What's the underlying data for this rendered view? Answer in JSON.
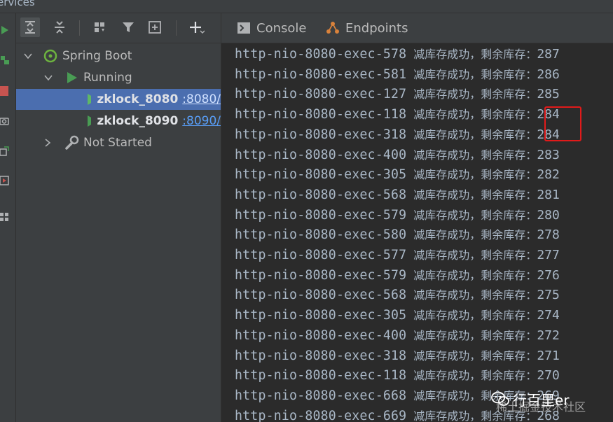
{
  "window": {
    "title_fragment": "ervices"
  },
  "tree": {
    "spring_boot": "Spring Boot",
    "running": "Running",
    "apps": [
      {
        "name": "zklock_8080",
        "port": ":8080/"
      },
      {
        "name": "zklock_8090",
        "port": ":8090/"
      }
    ],
    "not_started": "Not Started"
  },
  "tabs": {
    "console": "Console",
    "endpoints": "Endpoints"
  },
  "console": {
    "lines": [
      {
        "thread": "http-nio-8080-exec-578",
        "message": "减库存成功，剩余库存：",
        "value": "287"
      },
      {
        "thread": "http-nio-8080-exec-581",
        "message": "减库存成功，剩余库存：",
        "value": "286"
      },
      {
        "thread": "http-nio-8080-exec-127",
        "message": "减库存成功，剩余库存：",
        "value": "285"
      },
      {
        "thread": "http-nio-8080-exec-118",
        "message": "减库存成功，剩余库存：",
        "value": "284"
      },
      {
        "thread": "http-nio-8080-exec-318",
        "message": "减库存成功，剩余库存：",
        "value": "284"
      },
      {
        "thread": "http-nio-8080-exec-400",
        "message": "减库存成功，剩余库存：",
        "value": "283"
      },
      {
        "thread": "http-nio-8080-exec-305",
        "message": "减库存成功，剩余库存：",
        "value": "282"
      },
      {
        "thread": "http-nio-8080-exec-568",
        "message": "减库存成功，剩余库存：",
        "value": "281"
      },
      {
        "thread": "http-nio-8080-exec-579",
        "message": "减库存成功，剩余库存：",
        "value": "280"
      },
      {
        "thread": "http-nio-8080-exec-580",
        "message": "减库存成功，剩余库存：",
        "value": "278"
      },
      {
        "thread": "http-nio-8080-exec-577",
        "message": "减库存成功，剩余库存：",
        "value": "277"
      },
      {
        "thread": "http-nio-8080-exec-579",
        "message": "减库存成功，剩余库存：",
        "value": "276"
      },
      {
        "thread": "http-nio-8080-exec-568",
        "message": "减库存成功，剩余库存：",
        "value": "275"
      },
      {
        "thread": "http-nio-8080-exec-305",
        "message": "减库存成功，剩余库存：",
        "value": "274"
      },
      {
        "thread": "http-nio-8080-exec-400",
        "message": "减库存成功，剩余库存：",
        "value": "272"
      },
      {
        "thread": "http-nio-8080-exec-318",
        "message": "减库存成功，剩余库存：",
        "value": "271"
      },
      {
        "thread": "http-nio-8080-exec-118",
        "message": "减库存成功，剩余库存：",
        "value": "270"
      },
      {
        "thread": "http-nio-8080-exec-668",
        "message": "减库存成功，剩余库存：",
        "value": "269"
      },
      {
        "thread": "http-nio-8080-exec-669",
        "message": "减库存成功，剩余库存：",
        "value": "268"
      }
    ]
  },
  "watermark": {
    "name": "行百里er",
    "sub": "稀土掘金技术社区"
  },
  "colors": {
    "selection": "#4b6eaf",
    "run_green": "#499c54",
    "highlight_red": "#e11a1a",
    "link_blue": "#589df6"
  }
}
